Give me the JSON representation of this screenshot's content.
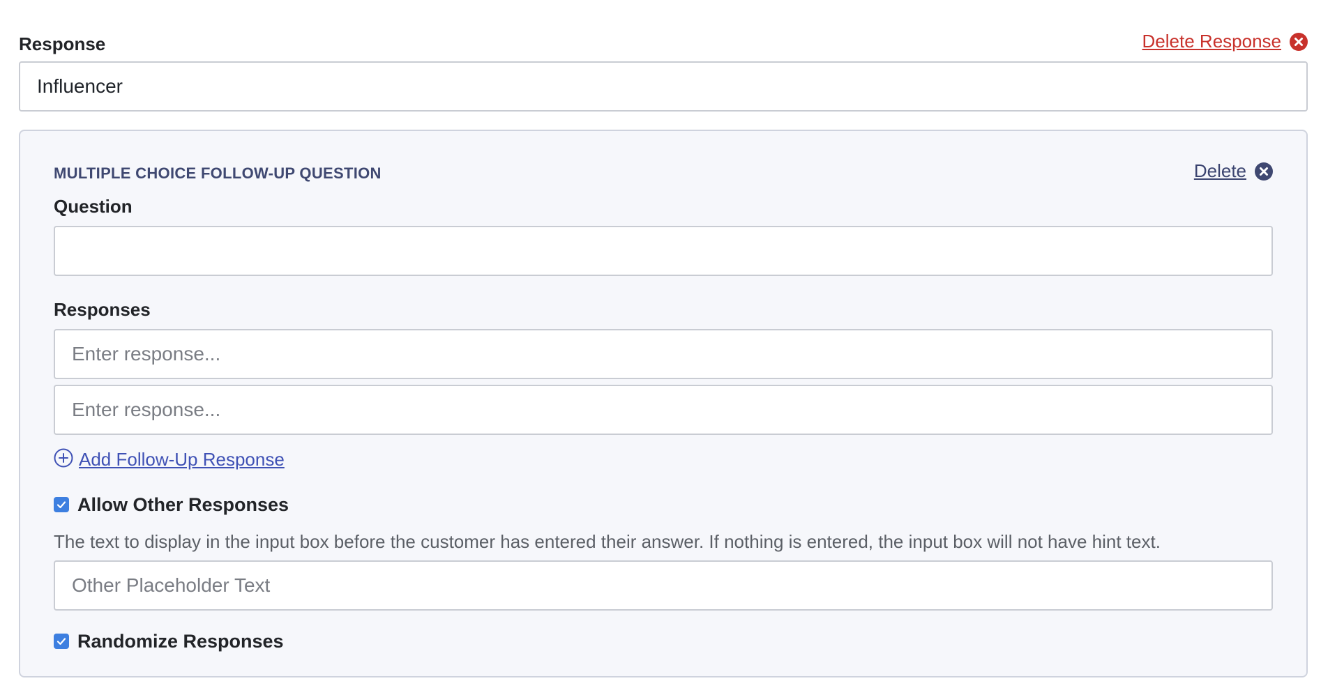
{
  "response": {
    "label": "Response",
    "delete_label": "Delete Response",
    "value": "Influencer",
    "colors": {
      "delete": "#c8312b"
    }
  },
  "followup": {
    "title": "MULTIPLE CHOICE FOLLOW-UP QUESTION",
    "delete_label": "Delete",
    "question_label": "Question",
    "question_value": "",
    "responses_label": "Responses",
    "responses": [
      {
        "value": "",
        "placeholder": "Enter response..."
      },
      {
        "value": "",
        "placeholder": "Enter response..."
      }
    ],
    "add_response_label": "Add Follow-Up Response",
    "allow_other": {
      "label": "Allow Other Responses",
      "checked": true
    },
    "other_hint": "The text to display in the input box before the customer has entered their answer. If nothing is entered, the input box will not have hint text.",
    "other_placeholder": "Other Placeholder Text",
    "randomize": {
      "label": "Randomize Responses",
      "checked": true
    },
    "colors": {
      "title": "#3f4871",
      "link": "#3f51b5",
      "checkbox": "#3d7fe0",
      "panel_bg": "#f6f7fb"
    }
  },
  "icons": {
    "delete_response": "circle-x-icon",
    "delete_followup": "circle-x-icon",
    "add": "plus-circle-icon",
    "check": "check-icon"
  }
}
